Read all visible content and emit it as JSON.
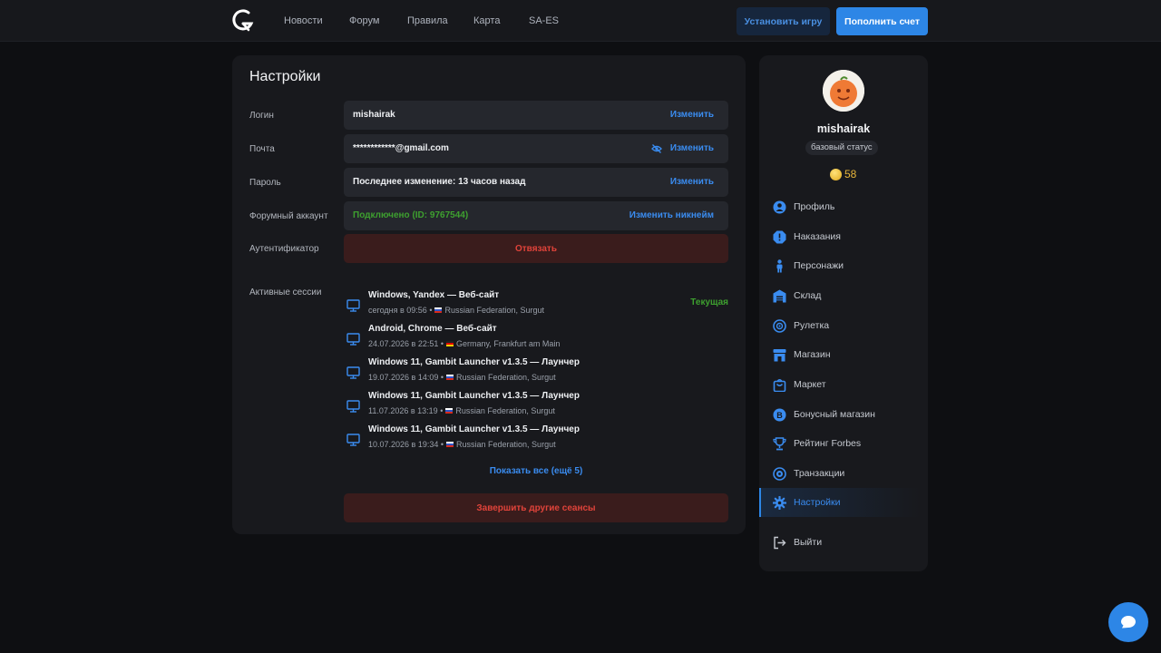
{
  "nav": {
    "items": [
      "Новости",
      "Форум",
      "Правила",
      "Карта",
      "SA-ES"
    ]
  },
  "header": {
    "install_label": "Установить игру",
    "topup_label": "Пополнить счет"
  },
  "settings": {
    "title": "Настройки",
    "rows": [
      {
        "label": "Логин",
        "value": "mishairak",
        "action": "Изменить"
      },
      {
        "label": "Почта",
        "value": "************@gmail.com",
        "action": "Изменить"
      },
      {
        "label": "Пароль",
        "value": "Последнее изменение: 13 часов назад",
        "action": "Изменить"
      },
      {
        "label": "Форумный аккаунт",
        "value": "Подключено (ID: 9767544)",
        "action": "Изменить никнейм"
      },
      {
        "label": "Аутентификатор",
        "action": "Отвязать"
      }
    ],
    "sessions_label": "Активные сессии",
    "current_label": "Текущая",
    "sessions": [
      {
        "title": "Windows, Yandex — Веб-сайт",
        "time": "сегодня в 09:56",
        "location": "Russian Federation, Surgut",
        "flag": "ru"
      },
      {
        "title": "Android, Chrome — Веб-сайт",
        "time": "24.07.2026 в 22:51",
        "location": "Germany, Frankfurt am Main",
        "flag": "de"
      },
      {
        "title": "Windows 11, Gambit Launcher v1.3.5 — Лаунчер",
        "time": "19.07.2026 в 14:09",
        "location": "Russian Federation, Surgut",
        "flag": "ru"
      },
      {
        "title": "Windows 11, Gambit Launcher v1.3.5 — Лаунчер",
        "time": "11.07.2026 в 13:19",
        "location": "Russian Federation, Surgut",
        "flag": "ru"
      },
      {
        "title": "Windows 11, Gambit Launcher v1.3.5 — Лаунчер",
        "time": "10.07.2026 в 19:34",
        "location": "Russian Federation, Surgut",
        "flag": "ru"
      }
    ],
    "show_all": "Показать все (ещё 5)",
    "end_sessions": "Завершить другие сеансы"
  },
  "profile": {
    "username": "mishairak",
    "status": "базовый статус",
    "coins": "58"
  },
  "menu": [
    {
      "label": "Профиль",
      "icon": "user-icon"
    },
    {
      "label": "Наказания",
      "icon": "warning-icon"
    },
    {
      "label": "Персонажи",
      "icon": "person-icon"
    },
    {
      "label": "Склад",
      "icon": "warehouse-icon"
    },
    {
      "label": "Рулетка",
      "icon": "roulette-icon"
    },
    {
      "label": "Магазин",
      "icon": "shop-icon"
    },
    {
      "label": "Маркет",
      "icon": "market-icon"
    },
    {
      "label": "Бонусный магазин",
      "icon": "bonus-icon"
    },
    {
      "label": "Рейтинг Forbes",
      "icon": "trophy-icon"
    },
    {
      "label": "Транзакции",
      "icon": "transactions-icon"
    },
    {
      "label": "Настройки",
      "icon": "gear-icon",
      "active": true
    },
    {
      "label": "Выйти",
      "icon": "logout-icon"
    }
  ],
  "colors": {
    "accent": "#2d86e6",
    "success": "#3ea02f",
    "danger": "#e0433a",
    "coin": "#e6b53a"
  }
}
